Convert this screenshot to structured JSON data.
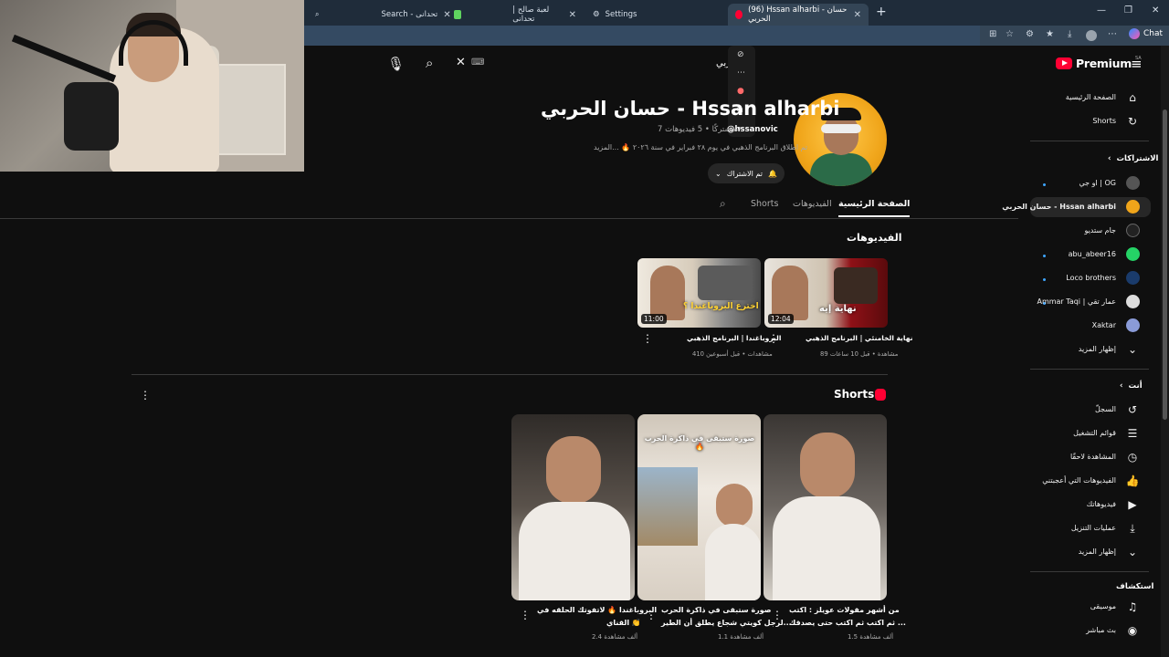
{
  "browser": {
    "tabs": [
      {
        "label": "Search - تحدانی"
      },
      {
        "label": "لعبة صالح | تحدانی"
      },
      {
        "label": "Settings"
      },
      {
        "label": "(96) Hssan alharbi - حسان الحربي"
      }
    ],
    "chat_label": "Chat"
  },
  "youtube": {
    "logo_text": "Premium",
    "logo_region": "SA",
    "search_value": "حربي"
  },
  "channel": {
    "title": "حسان الحربي - Hssan alharbi",
    "handle": "@hssanovic",
    "meta": "7 مشتركًا • 5 فيديوهات",
    "description": "تم اطلاق البرنامج الذهبي في يوم ٢٨ فبراير في سنة ٢٠٢٦ 🔥 ...المزيد",
    "subscribe_label": "تم الاشتراك",
    "tabs": [
      "الصفحة الرئيسية",
      "الفيديوهات",
      "Shorts"
    ]
  },
  "videos_section": {
    "title": "الفيديوهات",
    "items": [
      {
        "title": "نهاية الخامنئي | البرنامج الذهبي",
        "stats": "89 مشاهدة • قبل 10 ساعات",
        "duration": "12:04",
        "thumb_text": "نهاية إيه"
      },
      {
        "title": "البروباغندا | البرنامج الذهبي",
        "stats": "410 مشاهدات • قبل أسبوعين",
        "duration": "11:00",
        "thumb_text": "مين أول واحد اخترع البروباغندا ؟"
      }
    ]
  },
  "shorts_section": {
    "title": "Shorts",
    "items": [
      {
        "title_line1": "من أشهر مقولات عويلز : اكتب",
        "title_line2": "ثم اكتب ثم اكتب حتى يصدقك ...",
        "views": "1.5 ألف مشاهدة"
      },
      {
        "title_line1": "صورة ستبقى في ذاكرة الحرب",
        "title_line2": "لرجل كويتي شجاع يطلق أن الطير...",
        "views": "1.1 ألف مشاهدة",
        "thumb_text": "صورة ستبقى في ذاكرة الحرب 🔥"
      },
      {
        "title_line1": "البروباغندا 🔥 لاتفوتك الحلقه في",
        "title_line2": "القناي 👏",
        "views": "2.4 ألف مشاهدة"
      }
    ]
  },
  "sidebar": {
    "main": [
      {
        "label": "الصفحة الرئيسية",
        "icon": "home-icon"
      },
      {
        "label": "Shorts",
        "icon": "shorts-icon"
      }
    ],
    "subscriptions_header": "الاشتراكات",
    "subscriptions": [
      {
        "label": "او جي | OG",
        "color": "#555555"
      },
      {
        "label": "حسان الحربي - Hssan alharbi",
        "color": "#f0a51a"
      },
      {
        "label": "جام ستديو",
        "color": "#222222"
      },
      {
        "label": "abu_abeer16",
        "color": "#25d366"
      },
      {
        "label": "Loco brothers",
        "color": "#1a3b6b"
      },
      {
        "label": "Ammar Taqi | عمار تقي",
        "color": "#dddddd"
      },
      {
        "label": "Xaktar",
        "color": "#8a9bd8"
      }
    ],
    "show_more": "إظهار المزيد",
    "you_header": "أنت",
    "you_items": [
      {
        "label": "السجلّ",
        "icon": "history-icon"
      },
      {
        "label": "قوائم التشغيل",
        "icon": "playlist-icon"
      },
      {
        "label": "المشاهدة لاحقًا",
        "icon": "clock-icon"
      },
      {
        "label": "الفيديوهات التي أعجبتني",
        "icon": "like-icon"
      },
      {
        "label": "فيديوهاتك",
        "icon": "video-icon"
      },
      {
        "label": "عمليات التنزيل",
        "icon": "download-icon"
      },
      {
        "label": "إظهار المزيد",
        "icon": "chevron-down-icon"
      }
    ],
    "explore_header": "استكشاف",
    "explore_items": [
      {
        "label": "موسيقى",
        "icon": "music-icon"
      },
      {
        "label": "بث مباشر",
        "icon": "live-icon"
      }
    ]
  }
}
